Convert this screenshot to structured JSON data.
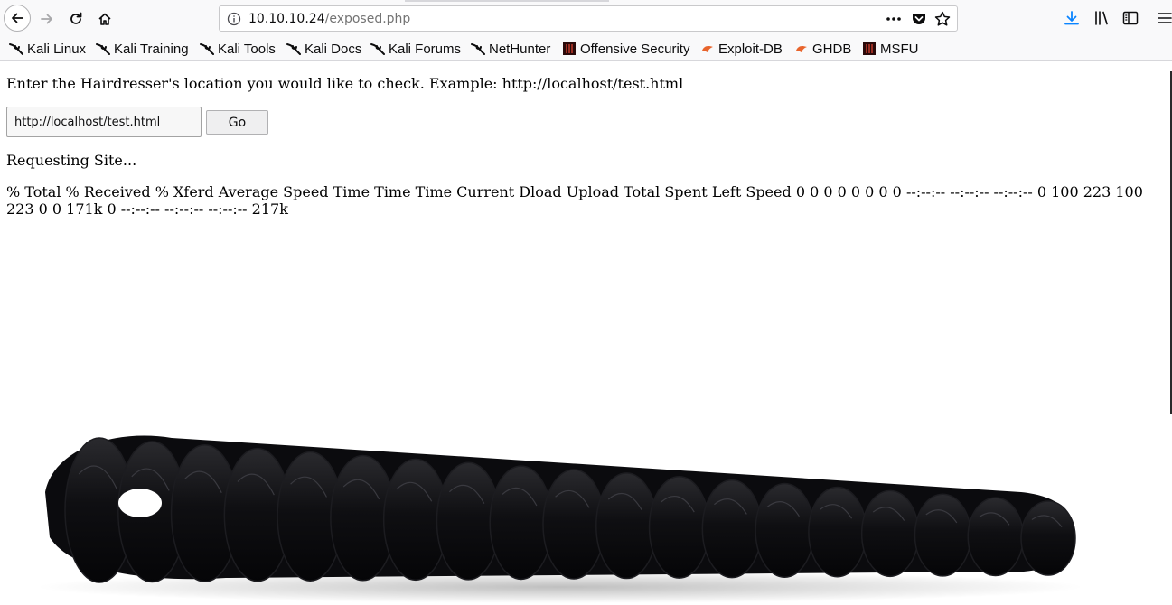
{
  "browser": {
    "url_host": "10.10.10.24",
    "url_path": "/exposed.php",
    "bookmarks": [
      {
        "label": "Kali Linux",
        "icon": "kali-dragon-icon"
      },
      {
        "label": "Kali Training",
        "icon": "kali-dragon-icon"
      },
      {
        "label": "Kali Tools",
        "icon": "kali-dragon-icon"
      },
      {
        "label": "Kali Docs",
        "icon": "kali-dragon-icon"
      },
      {
        "label": "Kali Forums",
        "icon": "kali-dragon-icon"
      },
      {
        "label": "NetHunter",
        "icon": "kali-dragon-icon"
      },
      {
        "label": "Offensive Security",
        "icon": "offsec-icon"
      },
      {
        "label": "Exploit-DB",
        "icon": "exploit-db-icon"
      },
      {
        "label": "GHDB",
        "icon": "exploit-db-icon"
      },
      {
        "label": "MSFU",
        "icon": "offsec-icon"
      }
    ]
  },
  "page": {
    "prompt": "Enter the Hairdresser's location you would like to check. Example: http://localhost/test.html",
    "input_value": "http://localhost/test.html",
    "go_label": "Go",
    "requesting": "Requesting Site...",
    "curl_output": "% Total % Received % Xferd Average Speed Time Time Time Current Dload Upload Total Spent Left Speed 0 0 0 0 0 0 0 0 --:--:-- --:--:-- --:--:-- 0 100 223 100 223 0 0 171k 0 --:--:-- --:--:-- --:--:-- 217k"
  }
}
